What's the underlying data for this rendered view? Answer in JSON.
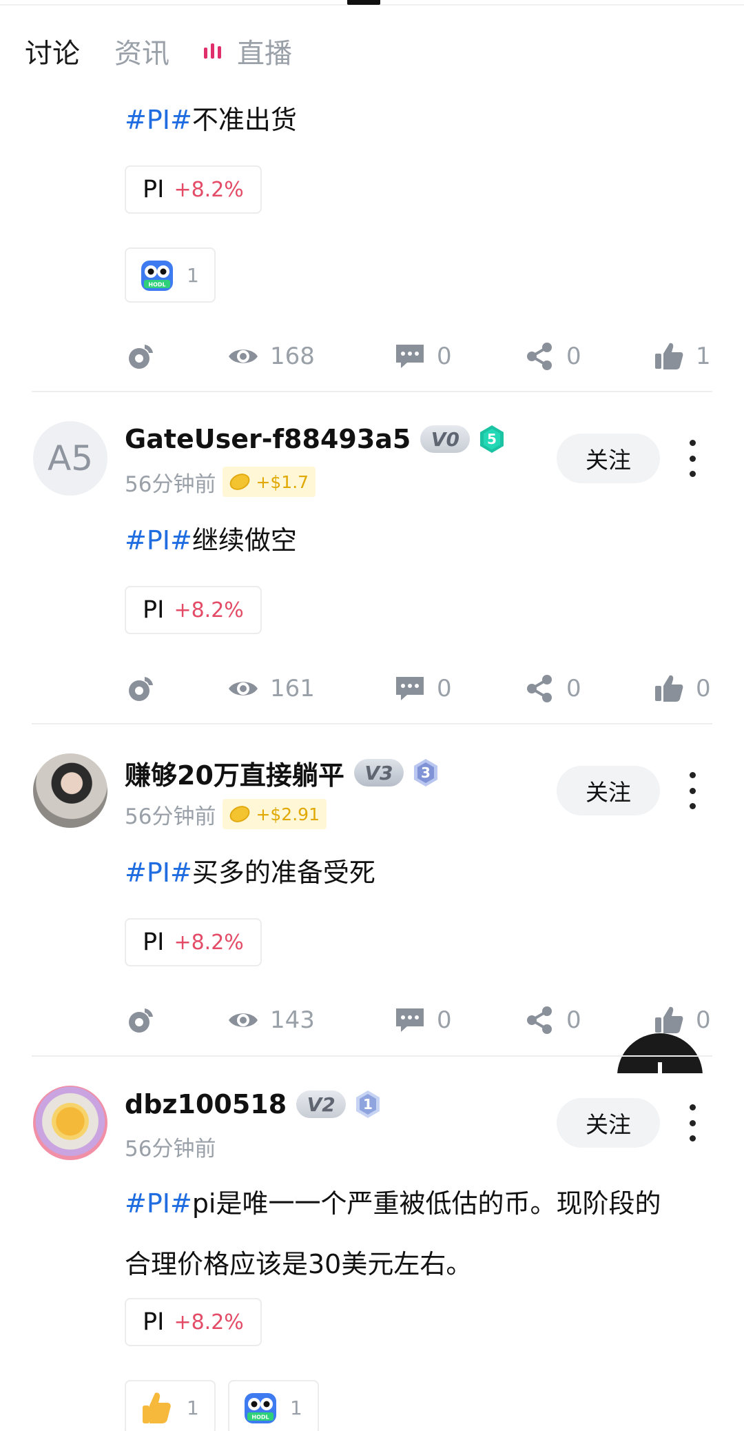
{
  "tabs": [
    {
      "label": "讨论",
      "active": true
    },
    {
      "label": "资讯",
      "active": false
    },
    {
      "label": "直播",
      "active": false,
      "icon": "live-bars-icon"
    }
  ],
  "colors": {
    "tag": "#1f6de0",
    "positive": "#e34b66",
    "live": "#e0306b",
    "muted": "#9aa0a8"
  },
  "posts": [
    {
      "tag": "#PI#",
      "text": "不准出货",
      "coin": {
        "symbol": "PI",
        "change": "+8.2%"
      },
      "reactions": [
        {
          "emoji": "hodl-owl-icon",
          "count": "1"
        }
      ],
      "stats": {
        "views": "168",
        "comments": "0",
        "shares": "0",
        "likes": "1"
      }
    },
    {
      "avatar_text": "A5",
      "username": "GateUser-f88493a5",
      "vip": "V0",
      "level": "5",
      "time": "56分钟前",
      "reward": "+$1.7",
      "follow": "关注",
      "tag": "#PI#",
      "text": "继续做空",
      "coin": {
        "symbol": "PI",
        "change": "+8.2%"
      },
      "stats": {
        "views": "161",
        "comments": "0",
        "shares": "0",
        "likes": "0"
      }
    },
    {
      "username": "赚够20万直接躺平",
      "vip": "V3",
      "level": "3",
      "time": "56分钟前",
      "reward": "+$2.91",
      "follow": "关注",
      "tag": "#PI#",
      "text": "买多的准备受死",
      "coin": {
        "symbol": "PI",
        "change": "+8.2%"
      },
      "stats": {
        "views": "143",
        "comments": "0",
        "shares": "0",
        "likes": "0"
      }
    },
    {
      "username": "dbz100518",
      "vip": "V2",
      "level": "1",
      "time": "56分钟前",
      "follow": "关注",
      "tag": "#PI#",
      "text_line1": "pi是唯一一个严重被低估的币。现阶段的",
      "text_line2": "合理价格应该是30美元左右。",
      "coin": {
        "symbol": "PI",
        "change": "+8.2%"
      },
      "reactions": [
        {
          "emoji": "thumbs-up-emoji-icon",
          "count": "1"
        },
        {
          "emoji": "hodl-owl-icon",
          "count": "1"
        }
      ]
    }
  ]
}
